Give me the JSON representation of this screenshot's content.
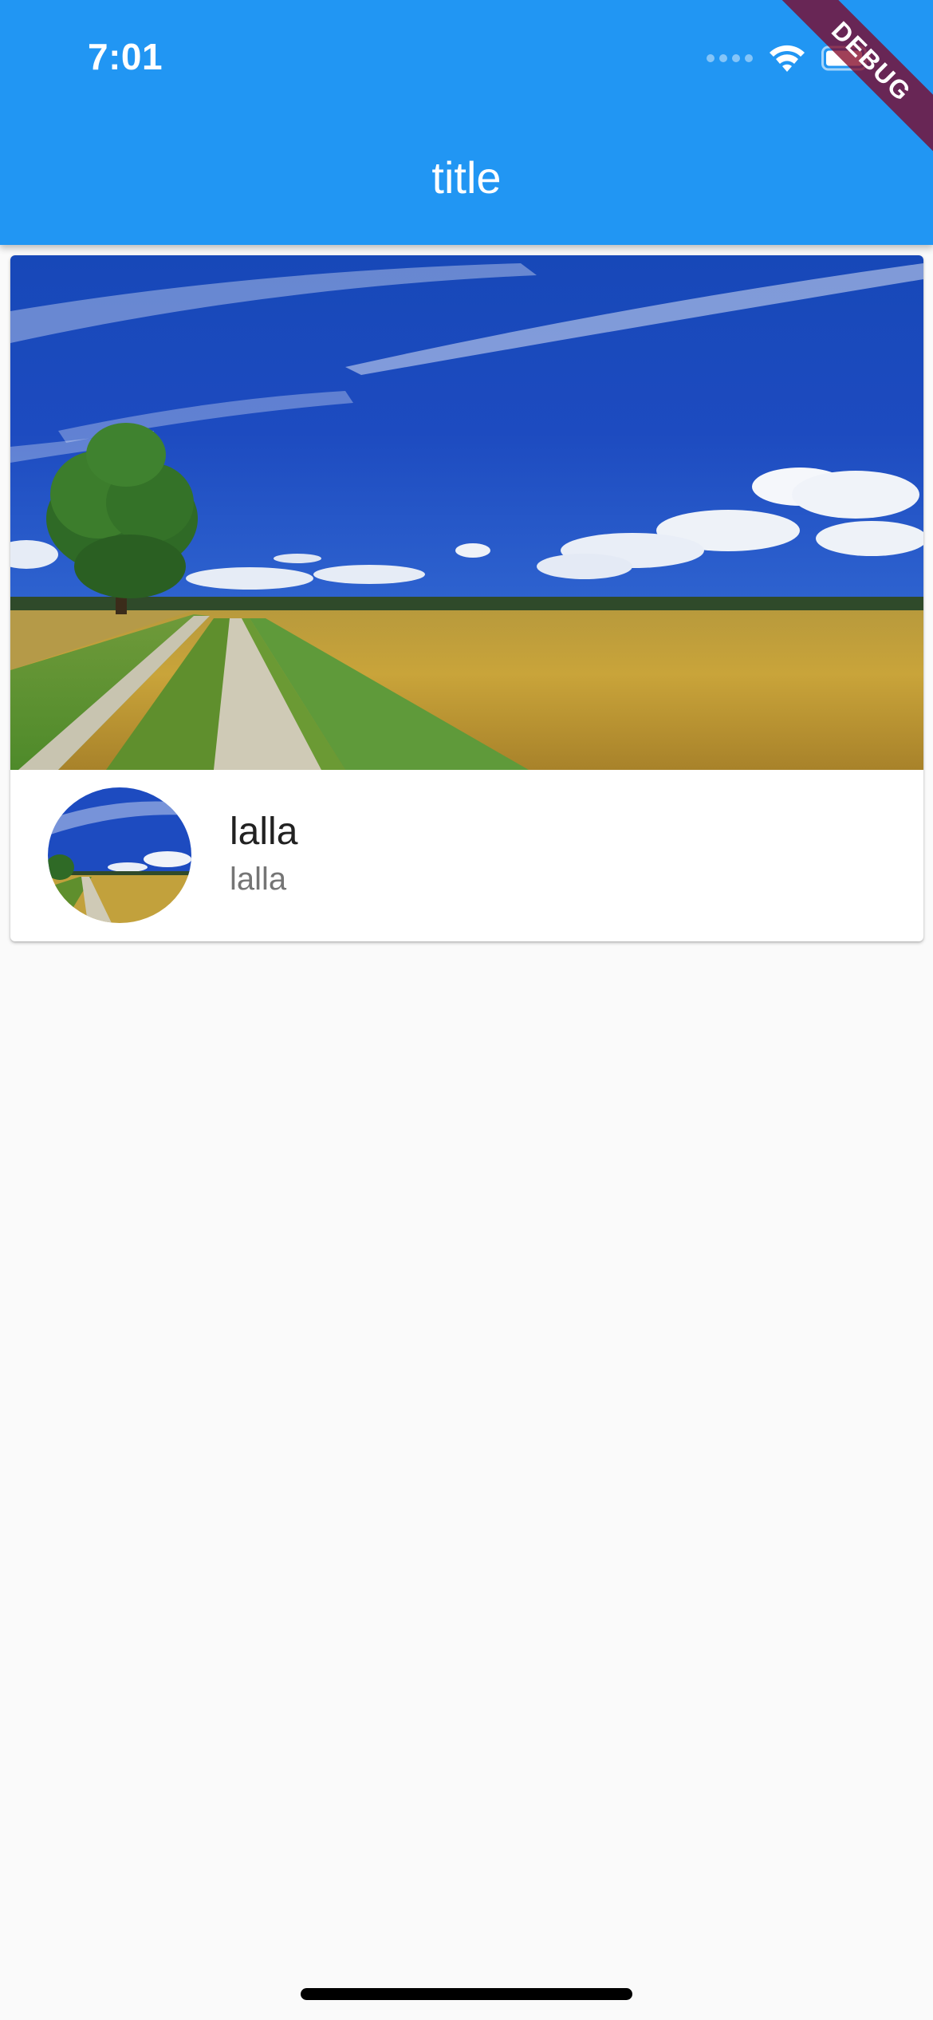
{
  "status_bar": {
    "time": "7:01"
  },
  "app_bar": {
    "title": "title"
  },
  "debug_banner": {
    "label": "DEBUG"
  },
  "card": {
    "image_icon": "landscape-photo",
    "title": "lalla",
    "subtitle": "lalla"
  },
  "colors": {
    "app_bar": "#2196f3",
    "background": "#fafafa",
    "card": "#ffffff",
    "debug_ribbon": "#8a1c35"
  }
}
